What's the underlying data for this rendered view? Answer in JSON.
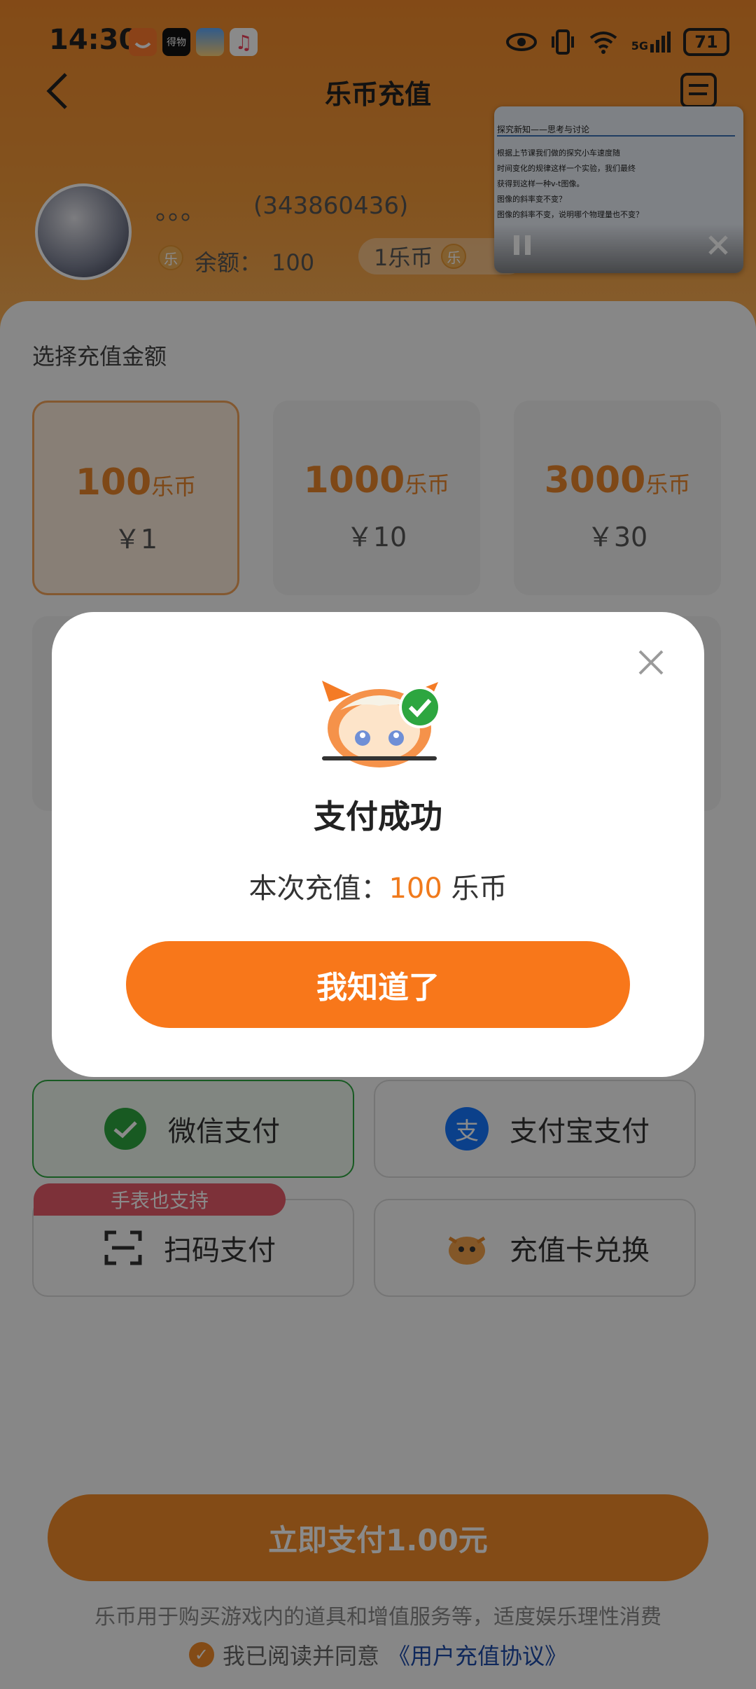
{
  "status_bar": {
    "time": "14:30",
    "network": "5G",
    "battery": "71",
    "app_icons": [
      "taobao-app-icon",
      "dewu-app-icon",
      "weather-app-icon",
      "music-app-icon"
    ],
    "app_icon_texts": [
      "",
      "得物",
      "",
      ""
    ]
  },
  "header": {
    "title": "乐币充值"
  },
  "account": {
    "name": "。。。",
    "id": "(343860436)",
    "balance_label": "余额：",
    "balance_value": "100",
    "rate_text": "1乐币",
    "coin_glyph": "乐"
  },
  "pip_video": {
    "title": "探究新知——思考与讨论",
    "lines": [
      "根据上节课我们做的探究小车速度随",
      "时间变化的规律这样一个实验，我们最终",
      "获得到这样一种v-t图像。",
      "图像的斜率变不变？",
      "图像的斜率不变，说明哪个物理量也不变？"
    ]
  },
  "recharge": {
    "section_title": "选择充值金额",
    "unit": "乐币",
    "options": [
      {
        "amount": "100",
        "price": "￥1",
        "selected": true
      },
      {
        "amount": "1000",
        "price": "￥10",
        "selected": false
      },
      {
        "amount": "3000",
        "price": "￥30",
        "selected": false
      }
    ]
  },
  "payment_methods": [
    {
      "label": "微信支付",
      "selected": true
    },
    {
      "label": "支付宝支付",
      "selected": false
    },
    {
      "label": "扫码支付",
      "selected": false
    },
    {
      "label": "充值卡兑换",
      "selected": false
    }
  ],
  "alipay_glyph": "支",
  "scan_badge": "手表也支持",
  "pay_button": "立即支付1.00元",
  "notice": "乐币用于购买游戏内的道具和增值服务等，适度娱乐理性消费",
  "agreement": {
    "prefix": "我已阅读并同意",
    "link": "《用户充值协议》"
  },
  "modal": {
    "title": "支付成功",
    "msg_prefix": "本次充值：",
    "msg_amount": "100",
    "msg_unit": " 乐币",
    "button": "我知道了"
  },
  "colors": {
    "brand_orange": "#f8771a",
    "wechat_green": "#2da640",
    "alipay_blue": "#1677ff",
    "badge_red": "#e75b6a",
    "link_blue": "#1d4aa8"
  }
}
